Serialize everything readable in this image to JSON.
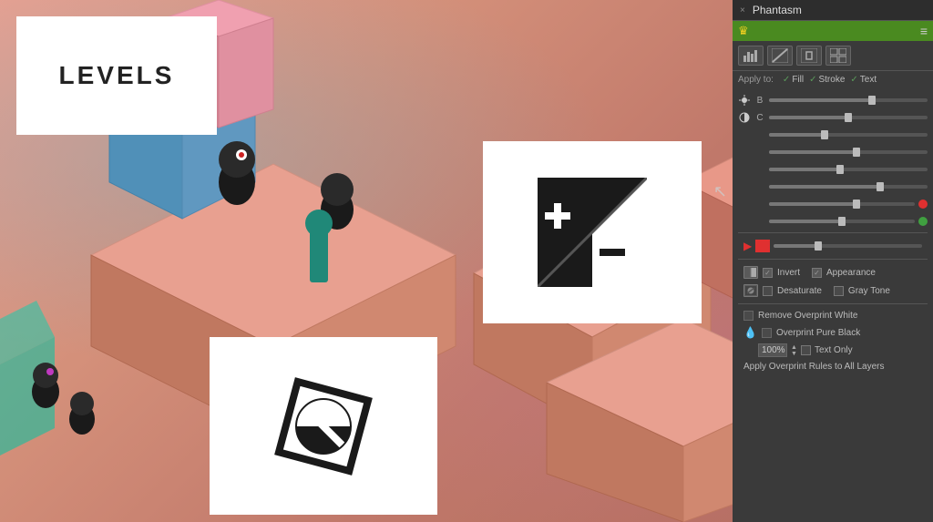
{
  "panel": {
    "title": "Phantasm",
    "close_label": "×",
    "green_bar": {
      "crown": "♛",
      "menu": "≡"
    },
    "toolbar": {
      "buttons": [
        {
          "id": "histogram",
          "label": "▦",
          "active": false
        },
        {
          "id": "curves",
          "label": "╱",
          "active": false
        },
        {
          "id": "levels",
          "label": "⊡",
          "active": false
        },
        {
          "id": "grid",
          "label": "⊞",
          "active": false
        }
      ]
    },
    "apply_to": {
      "label": "Apply to:",
      "fill": "Fill",
      "stroke": "Stroke",
      "text": "Text"
    },
    "sliders": {
      "b_label": "B",
      "c_label": "C",
      "rows": [
        {
          "label": "B",
          "fill_pct": 65
        },
        {
          "label": "C",
          "fill_pct": 50
        },
        {
          "label": "",
          "fill_pct": 40
        },
        {
          "label": "",
          "fill_pct": 55
        },
        {
          "label": "",
          "fill_pct": 45
        },
        {
          "label": "",
          "fill_pct": 70
        },
        {
          "label": "",
          "fill_pct": 60,
          "dot": "red"
        },
        {
          "label": "",
          "fill_pct": 50,
          "dot": "green"
        }
      ]
    },
    "options": {
      "invert_label": "Invert",
      "appearance_label": "Appearance",
      "desaturate_label": "Desaturate",
      "gray_tone_label": "Gray Tone",
      "remove_overprint_label": "Remove Overprint White",
      "overprint_black_label": "Overprint Pure Black",
      "percentage": "100%",
      "text_only_label": "Text Only",
      "apply_rules_label": "Apply Overprint Rules to All Layers"
    }
  },
  "levels_card": {
    "text": "LEVELS"
  },
  "plus_minus_card": {
    "alt": "Levels adjustment icon"
  },
  "circle_slash_card": {
    "alt": "Desaturate icon"
  }
}
